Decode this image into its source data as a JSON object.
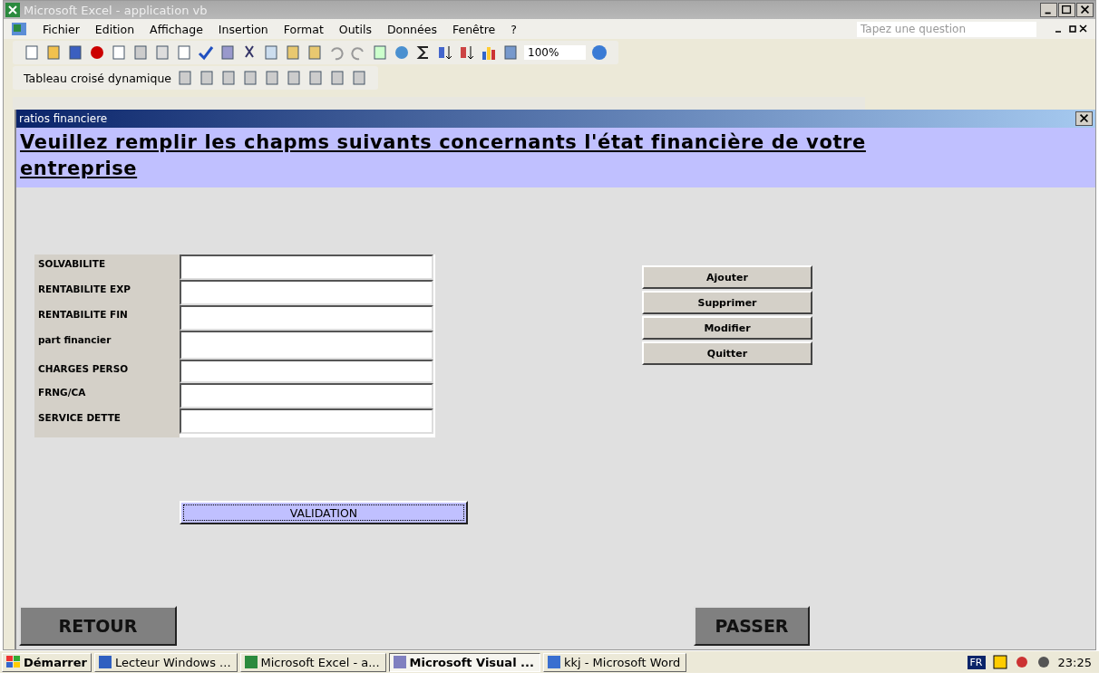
{
  "window": {
    "title": "Microsoft Excel - application vb"
  },
  "menu": [
    "Fichier",
    "Edition",
    "Affichage",
    "Insertion",
    "Format",
    "Outils",
    "Données",
    "Fenêtre",
    "?"
  ],
  "question_box": {
    "placeholder": "Tapez une question"
  },
  "zoom": "100%",
  "pivot_toolbar": {
    "label": "Tableau croisé dynamique"
  },
  "dialog": {
    "title": "ratios financiere",
    "heading": "Veuillez remplir les chapms suivants concernants l'état financière de votre entreprise",
    "fields": [
      {
        "label": "SOLVABILITE"
      },
      {
        "label": "RENTABILITE EXP"
      },
      {
        "label": "RENTABILITE FIN"
      },
      {
        "label": "part financier"
      },
      {
        "label": "CHARGES PERSO"
      },
      {
        "label": "FRNG/CA"
      },
      {
        "label": "SERVICE DETTE"
      }
    ],
    "actions": [
      "Ajouter",
      "Supprimer",
      "Modifier",
      "Quitter"
    ],
    "validate": "VALIDATION",
    "back": "RETOUR",
    "next": "PASSER"
  },
  "taskbar": {
    "start": "Démarrer",
    "tasks": [
      {
        "label": "Lecteur Windows ...",
        "selected": false
      },
      {
        "label": "Microsoft Excel - a...",
        "selected": false
      },
      {
        "label": "Microsoft Visual ...",
        "selected": true
      },
      {
        "label": "kkj - Microsoft Word",
        "selected": false
      }
    ],
    "language": "FR",
    "clock": "23:25"
  }
}
